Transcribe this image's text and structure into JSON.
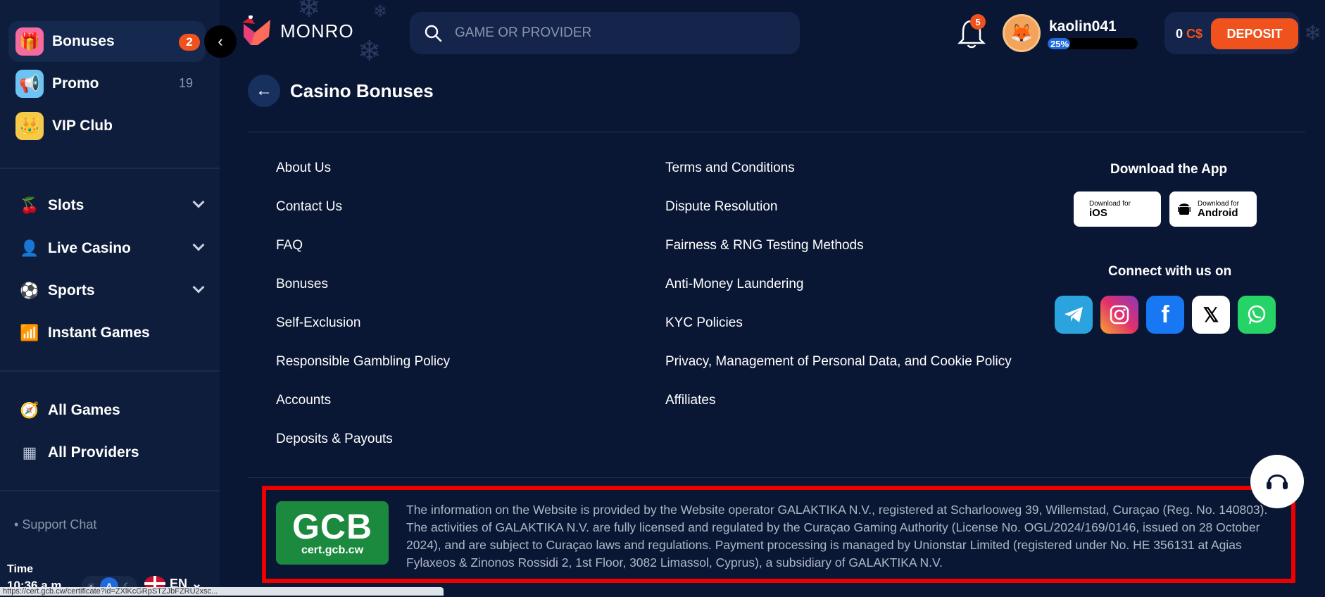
{
  "sidebar": {
    "top_items": [
      {
        "label": "Bonuses",
        "badge": "2"
      },
      {
        "label": "Promo",
        "count": "19"
      },
      {
        "label": "VIP Club"
      }
    ],
    "categories": [
      {
        "label": "Slots"
      },
      {
        "label": "Live Casino"
      },
      {
        "label": "Sports"
      },
      {
        "label": "Instant Games"
      }
    ],
    "links": [
      {
        "label": "All Games"
      },
      {
        "label": "All Providers"
      }
    ],
    "support": "Support Chat",
    "time_label": "Time",
    "time_value": "10:36 a.m.",
    "theme_auto": "A",
    "language": "EN"
  },
  "header": {
    "brand": "MONRO",
    "search_placeholder": "GAME OR PROVIDER",
    "notifications": "5",
    "username": "kaolin041",
    "level_percent": "25%",
    "level_value": 25,
    "balance": "0",
    "currency": "C$",
    "deposit_label": "DEPOSIT"
  },
  "page": {
    "title": "Casino Bonuses"
  },
  "footer": {
    "col1": [
      "About Us",
      "Contact Us",
      "FAQ",
      "Bonuses",
      "Self-Exclusion",
      "Responsible Gambling Policy",
      "Accounts",
      "Deposits & Payouts"
    ],
    "col2": [
      "Terms and Conditions",
      "Dispute Resolution",
      "Fairness & RNG Testing Methods",
      "Anti-Money Laundering",
      "KYC Policies",
      "Privacy, Management of Personal Data, and Cookie Policy",
      "Affiliates"
    ],
    "app_title": "Download the App",
    "ios": {
      "small": "Download for",
      "big": "iOS"
    },
    "android": {
      "small": "Download for",
      "big": "Android"
    },
    "connect_title": "Connect with us on",
    "gcb_main": "GCB",
    "gcb_sub": "cert.gcb.cw",
    "legal": "The information on the Website is provided by the Website operator GALAKTIKA N.V., registered at Scharlooweg 39, Willemstad, Curaçao (Reg. No. 140803). The activities of GALAKTIKA N.V. are fully licensed and regulated by the Curaçao Gaming Authority (License No. OGL/2024/169/0146, issued on 28 October 2024), and are subject to Curaçao laws and regulations. Payment processing is managed by Unionstar Limited (registered under No. HE 356131 at Agias Fylaxeos & Zinonos Rossidi 2, 1st Floor, 3082 Limassol, Cyprus), a subsidiary of GALAKTIKA N.V."
  },
  "statusbar": "https://cert.gcb.cw/certificate?id=ZXlKcGRpSTZJbFZRU2xsc..."
}
